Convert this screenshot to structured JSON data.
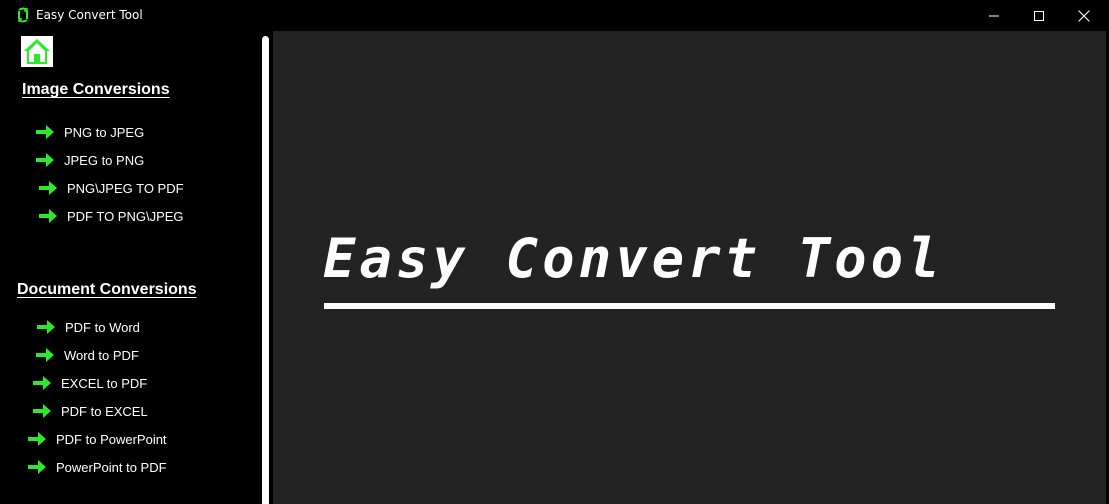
{
  "window": {
    "title": "Easy Convert Tool"
  },
  "sidebar": {
    "image_section": {
      "heading": "Image Conversions",
      "items": [
        {
          "label": "PNG to JPEG"
        },
        {
          "label": "JPEG to PNG"
        },
        {
          "label": "PNG\\JPEG TO PDF"
        },
        {
          "label": "PDF TO PNG\\JPEG"
        }
      ]
    },
    "document_section": {
      "heading": "Document Conversions",
      "items": [
        {
          "label": "PDF to Word"
        },
        {
          "label": "Word to PDF"
        },
        {
          "label": "EXCEL to PDF"
        },
        {
          "label": "PDF to EXCEL"
        },
        {
          "label": "PDF to PowerPoint"
        },
        {
          "label": "PowerPoint to PDF"
        }
      ]
    }
  },
  "main": {
    "title": "Easy Convert Tool"
  },
  "colors": {
    "accent": "#2ee82e",
    "main_background": "#232323",
    "sidebar_background": "#000000"
  },
  "icons": {
    "home": "home-icon",
    "arrow": "right-arrow-icon",
    "app": "app-sync-icon"
  }
}
